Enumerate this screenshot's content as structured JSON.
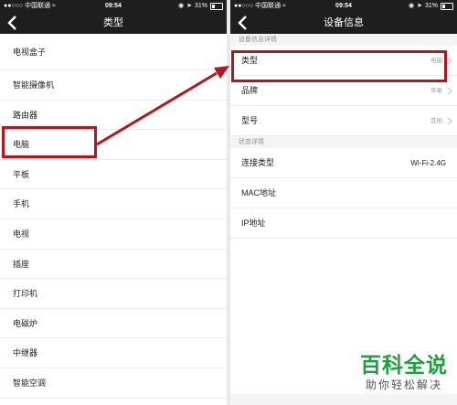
{
  "left": {
    "status": {
      "carrier": "●●○○○ 中国联通 ",
      "time": "09:54",
      "battery": "31%",
      "battery_level": 0.31
    },
    "title": "类型",
    "items": [
      "电视盒子",
      "智能摄像机",
      "路由器",
      "电脑",
      "平板",
      "手机",
      "电视",
      "插座",
      "打印机",
      "电磁炉",
      "中继器",
      "智能空调"
    ]
  },
  "right": {
    "status": {
      "carrier": "●●○○○ 中国联通 ",
      "time": "09:54",
      "battery": "31%",
      "battery_level": 0.31
    },
    "title": "设备信息",
    "section1": "设备信息详情",
    "rows1": [
      {
        "label": "类型",
        "value": "电脑"
      },
      {
        "label": "品牌",
        "value": "苹果"
      },
      {
        "label": "型号",
        "value": "其他"
      }
    ],
    "section2": "状态详情",
    "rows2": [
      {
        "label": "连接类型",
        "value": "Wi-Fi-2.4G"
      },
      {
        "label": "MAC地址",
        "value": ""
      },
      {
        "label": "IP地址",
        "value": ""
      }
    ]
  },
  "watermark": {
    "main": "百科全说",
    "sub": "助你轻松解决"
  },
  "colors": {
    "highlight": "#b5161c",
    "navbar": "#1e1e1e",
    "watermark": "#1fa040"
  }
}
